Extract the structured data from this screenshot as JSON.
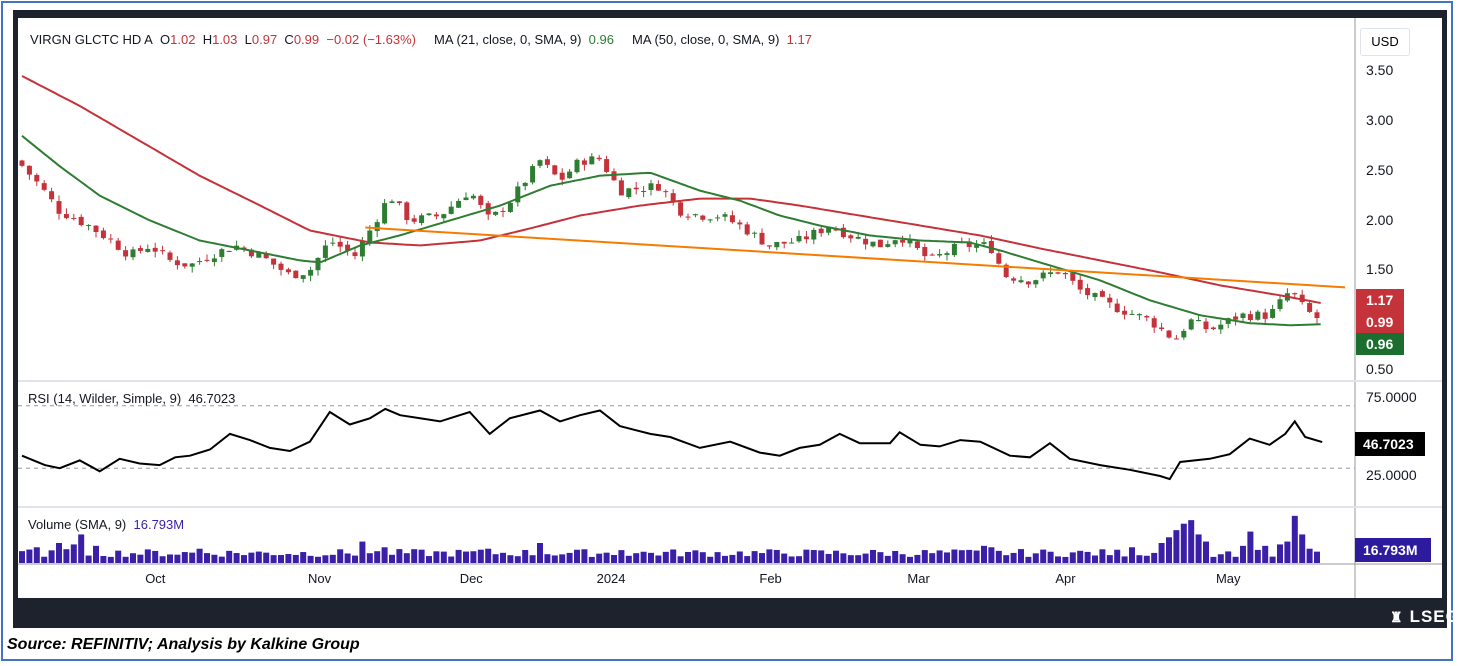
{
  "header": {
    "symbol": "VIRGN GLCTC HD A",
    "open_label": "O",
    "open": "1.02",
    "high_label": "H",
    "high": "1.03",
    "low_label": "L",
    "low": "0.97",
    "close_label": "C",
    "close": "0.99",
    "change": "−0.02 (−1.63%)",
    "ma21_label": "MA (21, close, 0, SMA, 9)",
    "ma21_value": "0.96",
    "ma50_label": "MA (50, close, 0, SMA, 9)",
    "ma50_value": "1.17"
  },
  "currency": "USD",
  "tags": {
    "ma50": "1.17",
    "close": "0.99",
    "ma21": "0.96",
    "rsi": "46.7023",
    "volume": "16.793M"
  },
  "rsi_label": "RSI (14, Wilder, Simple, 9)",
  "rsi_value": "46.7023",
  "volume_label": "Volume (SMA, 9)",
  "volume_value": "16.793M",
  "footer": {
    "source": "Source: REFINITIV; Analysis by Kalkine Group",
    "brand": "LSEG"
  },
  "colors": {
    "up": "#2e7d32",
    "down": "#c4323a",
    "ma21": "#2e7d32",
    "ma50": "#c4323a",
    "trend": "#f57c00",
    "rsi": "#000000",
    "volume": "#3b1fa6",
    "frame": "#1e222d"
  },
  "chart_data": {
    "type": "candlestick",
    "bars": 176,
    "price_axis": {
      "ticks": [
        3.5,
        3.0,
        2.5,
        2.0,
        1.5,
        0.5
      ],
      "labels": [
        "3.50",
        "3.00",
        "2.50",
        "2.00",
        "1.50",
        "0.50"
      ],
      "range": [
        0.4,
        3.6
      ]
    },
    "x_labels": [
      {
        "bar": 18,
        "label": "Oct"
      },
      {
        "bar": 40,
        "label": "Nov"
      },
      {
        "bar": 60.5,
        "label": "Dec"
      },
      {
        "bar": 79,
        "label": "2024"
      },
      {
        "bar": 101,
        "label": "Feb"
      },
      {
        "bar": 121,
        "label": "Mar"
      },
      {
        "bar": 141,
        "label": "Apr"
      },
      {
        "bar": 162.7,
        "label": "May"
      }
    ],
    "close_keypoints": [
      [
        0,
        2.55
      ],
      [
        2.4,
        2.35
      ],
      [
        5,
        2.1
      ],
      [
        9,
        1.95
      ],
      [
        12,
        1.8
      ],
      [
        14.6,
        1.65
      ],
      [
        17.3,
        1.75
      ],
      [
        20,
        1.6
      ],
      [
        22.7,
        1.55
      ],
      [
        25.4,
        1.65
      ],
      [
        28.8,
        1.75
      ],
      [
        32.2,
        1.65
      ],
      [
        36.2,
        1.45
      ],
      [
        38.9,
        1.5
      ],
      [
        41.6,
        1.8
      ],
      [
        45,
        1.65
      ],
      [
        47,
        1.9
      ],
      [
        49.7,
        2.25
      ],
      [
        52.4,
        2.0
      ],
      [
        56.5,
        2.05
      ],
      [
        60.5,
        2.3
      ],
      [
        63.2,
        2.0
      ],
      [
        66,
        2.2
      ],
      [
        70,
        2.6
      ],
      [
        72.7,
        2.4
      ],
      [
        75.4,
        2.6
      ],
      [
        78.1,
        2.62
      ],
      [
        80.8,
        2.3
      ],
      [
        86.2,
        2.35
      ],
      [
        88.9,
        2.1
      ],
      [
        91.6,
        2.05
      ],
      [
        94.3,
        2.05
      ],
      [
        97,
        1.95
      ],
      [
        101,
        1.75
      ],
      [
        105.1,
        1.8
      ],
      [
        109.2,
        1.95
      ],
      [
        111.9,
        1.85
      ],
      [
        115.9,
        1.75
      ],
      [
        118.6,
        1.85
      ],
      [
        122.7,
        1.6
      ],
      [
        126.8,
        1.75
      ],
      [
        130.8,
        1.75
      ],
      [
        132.8,
        1.45
      ],
      [
        136.2,
        1.4
      ],
      [
        140.3,
        1.5
      ],
      [
        143,
        1.3
      ],
      [
        147,
        1.15
      ],
      [
        152.4,
        1.0
      ],
      [
        155.8,
        0.8
      ],
      [
        157.8,
        1.0
      ],
      [
        160.5,
        0.9
      ],
      [
        164.6,
        1.05
      ],
      [
        168.6,
        1.05
      ],
      [
        171.4,
        1.3
      ],
      [
        173.4,
        1.1
      ],
      [
        175.7,
        0.99
      ]
    ],
    "ma21": {
      "name": "MA 21",
      "last": 0.96,
      "keypoints": [
        [
          0,
          2.85
        ],
        [
          5,
          2.55
        ],
        [
          10.5,
          2.25
        ],
        [
          17.3,
          2.0
        ],
        [
          24,
          1.8
        ],
        [
          30.8,
          1.7
        ],
        [
          37.6,
          1.6
        ],
        [
          40.3,
          1.58
        ],
        [
          45.7,
          1.75
        ],
        [
          51,
          1.85
        ],
        [
          57.8,
          2.0
        ],
        [
          64.6,
          2.15
        ],
        [
          71.4,
          2.35
        ],
        [
          78.1,
          2.45
        ],
        [
          84.9,
          2.48
        ],
        [
          91.6,
          2.3
        ],
        [
          97,
          2.2
        ],
        [
          102.4,
          2.05
        ],
        [
          107.8,
          1.95
        ],
        [
          114.6,
          1.85
        ],
        [
          121.4,
          1.8
        ],
        [
          128.1,
          1.78
        ],
        [
          132.2,
          1.7
        ],
        [
          138.9,
          1.55
        ],
        [
          145.7,
          1.4
        ],
        [
          152.4,
          1.2
        ],
        [
          159.2,
          1.05
        ],
        [
          166,
          0.97
        ],
        [
          171.4,
          0.95
        ],
        [
          175.7,
          0.96
        ]
      ]
    },
    "ma50": {
      "name": "MA 50",
      "last": 1.17,
      "keypoints": [
        [
          0,
          3.45
        ],
        [
          7.8,
          3.15
        ],
        [
          15.9,
          2.8
        ],
        [
          24,
          2.45
        ],
        [
          32.2,
          2.15
        ],
        [
          38.9,
          1.9
        ],
        [
          47,
          1.78
        ],
        [
          53.8,
          1.75
        ],
        [
          61.9,
          1.8
        ],
        [
          68.6,
          1.92
        ],
        [
          75.4,
          2.05
        ],
        [
          83.5,
          2.15
        ],
        [
          91.6,
          2.22
        ],
        [
          98.4,
          2.22
        ],
        [
          105.1,
          2.15
        ],
        [
          113.2,
          2.05
        ],
        [
          121.4,
          1.95
        ],
        [
          129.5,
          1.85
        ],
        [
          137.6,
          1.72
        ],
        [
          145.7,
          1.6
        ],
        [
          153.8,
          1.48
        ],
        [
          161.9,
          1.35
        ],
        [
          170,
          1.25
        ],
        [
          175.7,
          1.17
        ]
      ]
    },
    "trendline": {
      "from": [
        46.4,
        1.93
      ],
      "to": [
        178.8,
        1.33
      ]
    },
    "rsi": {
      "ticks": [
        75,
        25
      ],
      "labels": [
        "75.0000",
        "25.0000"
      ],
      "range": [
        15,
        85
      ],
      "bands": [
        70,
        30
      ],
      "last": 46.7023,
      "keypoints": [
        [
          0,
          38
        ],
        [
          3.1,
          32
        ],
        [
          5.1,
          30
        ],
        [
          7.8,
          35
        ],
        [
          10.5,
          28
        ],
        [
          13.2,
          36
        ],
        [
          15.9,
          33
        ],
        [
          18.6,
          32
        ],
        [
          20.7,
          37
        ],
        [
          22.7,
          38
        ],
        [
          25.4,
          42
        ],
        [
          28.1,
          52
        ],
        [
          30.8,
          48
        ],
        [
          33.5,
          43
        ],
        [
          36.2,
          41
        ],
        [
          38.9,
          47
        ],
        [
          41.6,
          66
        ],
        [
          44.3,
          58
        ],
        [
          47,
          62
        ],
        [
          49.1,
          68
        ],
        [
          51.1,
          64
        ],
        [
          53.8,
          62
        ],
        [
          56.5,
          60
        ],
        [
          60.5,
          66
        ],
        [
          63.2,
          52
        ],
        [
          65.9,
          62
        ],
        [
          70,
          67
        ],
        [
          72.7,
          60
        ],
        [
          75.4,
          64
        ],
        [
          78.1,
          67
        ],
        [
          80.8,
          57
        ],
        [
          84.9,
          52
        ],
        [
          87.6,
          50
        ],
        [
          91.6,
          43
        ],
        [
          95.7,
          47
        ],
        [
          99.7,
          40
        ],
        [
          102.4,
          38
        ],
        [
          105.1,
          43
        ],
        [
          107.8,
          45
        ],
        [
          110.5,
          52
        ],
        [
          113.2,
          46
        ],
        [
          117.3,
          46
        ],
        [
          118.6,
          53
        ],
        [
          121.4,
          45
        ],
        [
          124,
          44
        ],
        [
          126.8,
          48
        ],
        [
          129.5,
          47
        ],
        [
          133.5,
          38
        ],
        [
          136.2,
          37
        ],
        [
          138.9,
          46
        ],
        [
          141.6,
          36
        ],
        [
          145.7,
          32
        ],
        [
          149.7,
          29
        ],
        [
          153.8,
          25
        ],
        [
          155.1,
          23
        ],
        [
          156.5,
          34
        ],
        [
          160.5,
          36
        ],
        [
          163.2,
          39
        ],
        [
          165.9,
          49
        ],
        [
          168.6,
          45
        ],
        [
          170.7,
          52
        ],
        [
          172,
          60
        ],
        [
          173.4,
          50
        ],
        [
          175.7,
          46.7
        ]
      ]
    },
    "volume": {
      "unit": "M",
      "baseline": 14,
      "sma_last": 16.793,
      "max": 70,
      "spikes": [
        [
          2,
          22
        ],
        [
          5,
          28
        ],
        [
          7,
          26
        ],
        [
          8,
          40
        ],
        [
          10,
          24
        ],
        [
          24,
          20
        ],
        [
          46,
          30
        ],
        [
          49,
          22
        ],
        [
          63,
          20
        ],
        [
          70,
          28
        ],
        [
          81,
          18
        ],
        [
          130,
          24
        ],
        [
          131,
          22
        ],
        [
          150,
          22
        ],
        [
          154,
          28
        ],
        [
          155,
          36
        ],
        [
          156,
          46
        ],
        [
          157,
          55
        ],
        [
          158,
          60
        ],
        [
          159,
          40
        ],
        [
          160,
          30
        ],
        [
          165,
          24
        ],
        [
          166,
          44
        ],
        [
          168,
          24
        ],
        [
          170,
          26
        ],
        [
          171,
          30
        ],
        [
          172,
          66
        ],
        [
          173,
          40
        ],
        [
          174,
          20
        ]
      ]
    }
  }
}
